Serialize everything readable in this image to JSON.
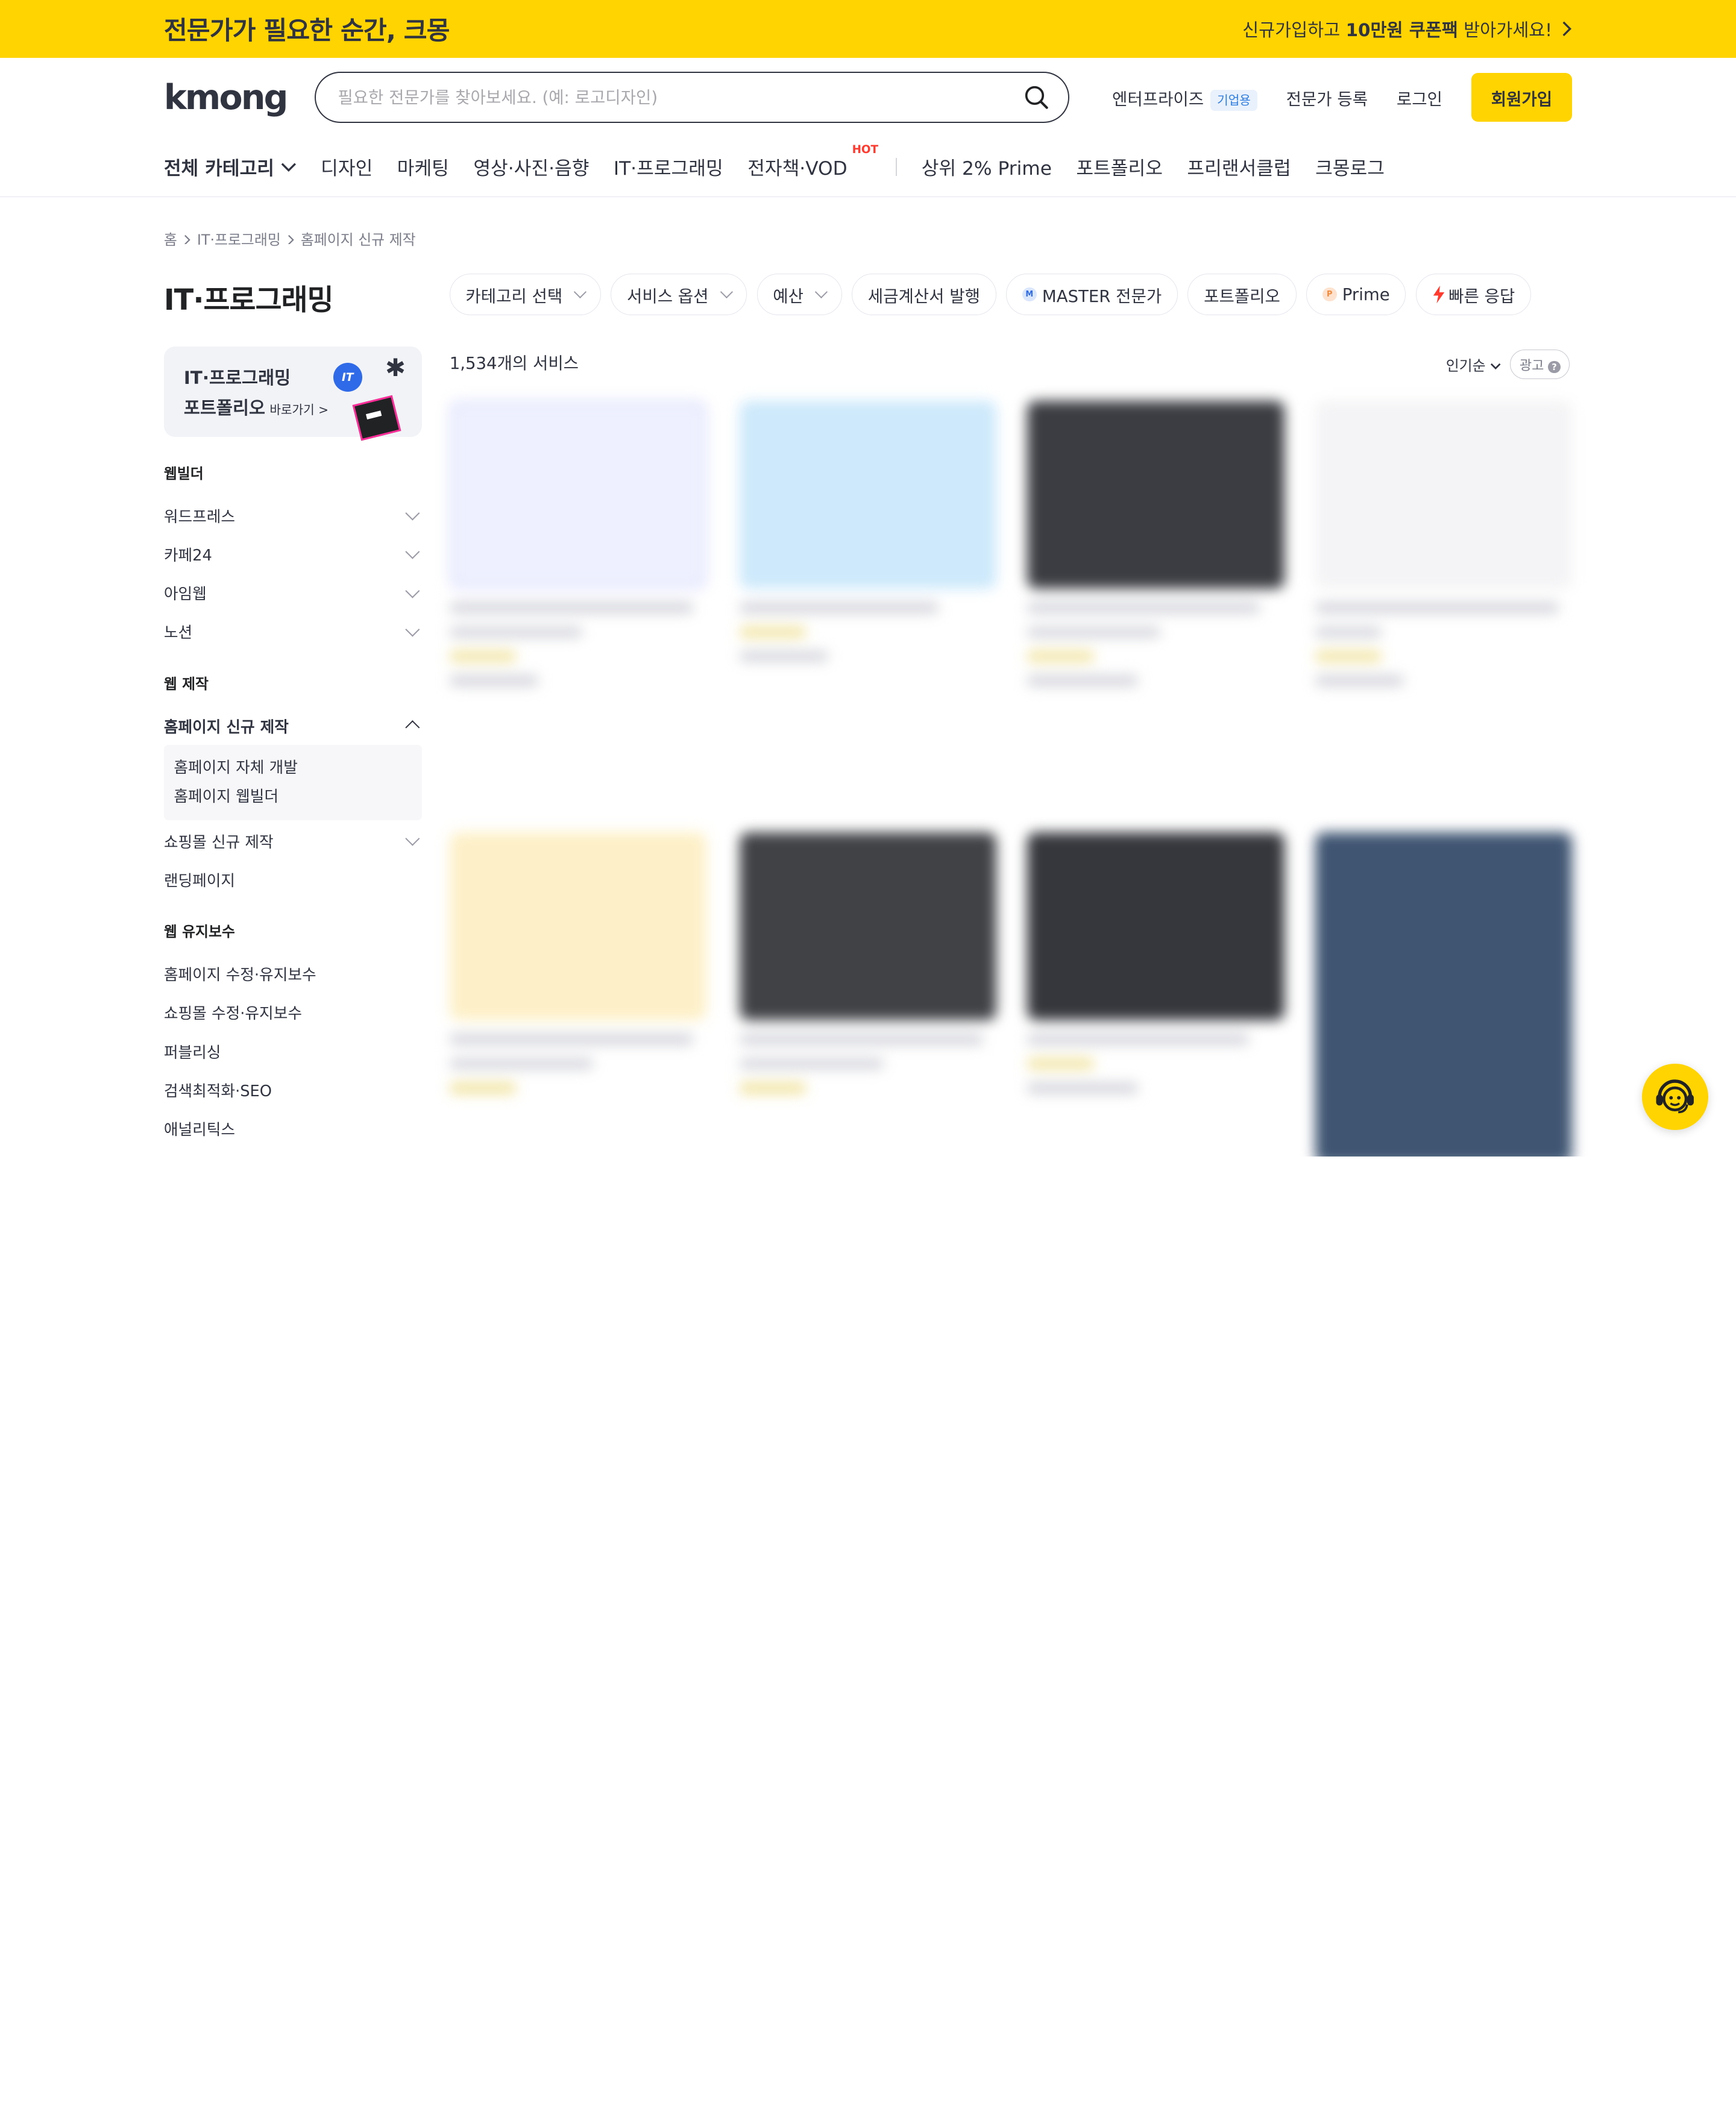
{
  "banner": {
    "title": "전문가가 필요한 순간, 크몽",
    "promo_pre": "신규가입하고 ",
    "promo_bold": "10만원 쿠폰팩",
    "promo_post": " 받아가세요!"
  },
  "header": {
    "logo": "kmong",
    "search_placeholder": "필요한 전문가를 찾아보세요. (예: 로고디자인)",
    "enterprise": "엔터프라이즈",
    "enterprise_badge": "기업용",
    "expert_register": "전문가 등록",
    "login": "로그인",
    "join": "회원가입"
  },
  "catnav": {
    "all": "전체 카테고리",
    "items": [
      "디자인",
      "마케팅",
      "영상·사진·음향",
      "IT·프로그래밍",
      "전자책·VOD"
    ],
    "hot_label": "HOT",
    "extra": [
      "상위 2% Prime",
      "포트폴리오",
      "프리랜서클럽",
      "크몽로그"
    ]
  },
  "breadcrumb": [
    "홈",
    "IT·프로그래밍",
    "홈페이지 신규 제작"
  ],
  "page_title": "IT·프로그래밍",
  "promo": {
    "line1": "IT·프로그래밍",
    "line2": "포트폴리오",
    "link": "바로가기 >",
    "badge": "IT"
  },
  "sidebar": {
    "group1": "웹빌더",
    "g1_items": [
      "워드프레스",
      "카페24",
      "아임웹",
      "노션"
    ],
    "group2": "웹 제작",
    "g2_active": "홈페이지 신규 제작",
    "g2_sub": [
      "홈페이지 자체 개발",
      "홈페이지 웹빌더"
    ],
    "g2_items": [
      "쇼핑몰 신규 제작",
      "랜딩페이지"
    ],
    "group3": "웹 유지보수",
    "g3_items": [
      "홈페이지 수정·유지보수",
      "쇼핑몰 수정·유지보수",
      "퍼블리싱",
      "검색최적화·SEO",
      "애널리틱스"
    ]
  },
  "filters": {
    "category": "카테고리 선택",
    "option": "서비스 옵션",
    "budget": "예산",
    "tax": "세금계산서 발행",
    "master": "MASTER 전문가",
    "portfolio": "포트폴리오",
    "prime": "Prime",
    "fast": "빠른 응답"
  },
  "results": {
    "count": "1,534개의 서비스",
    "sort": "인기순",
    "ad": "광고"
  },
  "colors": {
    "brand": "#FFD400",
    "text": "#303441"
  }
}
